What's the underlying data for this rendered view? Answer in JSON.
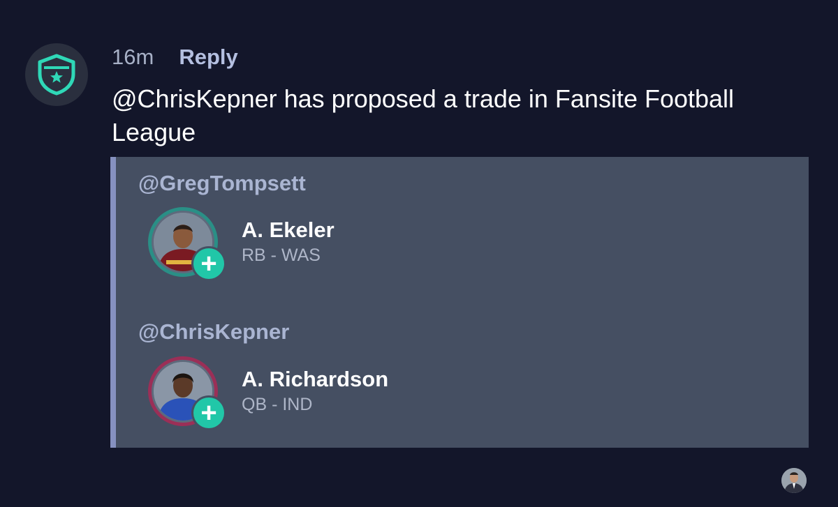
{
  "league_avatar": {
    "icon": "shield-star-icon",
    "color": "#2fd8b7"
  },
  "comment": {
    "time": "16m",
    "reply_label": "Reply",
    "message": "@ChrisKepner has proposed a trade in Fansite Football League"
  },
  "trade": {
    "sides": [
      {
        "user": "@GregTompsett",
        "player": {
          "name": "A. Ekeler",
          "position_team": "RB - WAS",
          "ring_color": "#2a8f86"
        }
      },
      {
        "user": "@ChrisKepner",
        "player": {
          "name": "A. Richardson",
          "position_team": "QB - IND",
          "ring_color": "#9b2f57"
        }
      }
    ],
    "add_icon": "+"
  },
  "colors": {
    "background": "#13162a",
    "card": "#454f62",
    "card_border": "#8691c0",
    "accent": "#21c7a8"
  }
}
